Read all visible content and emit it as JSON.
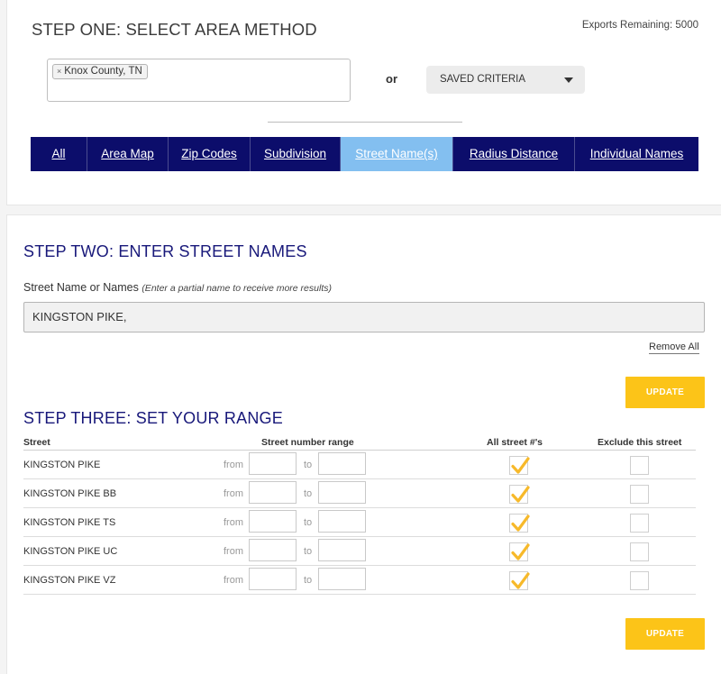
{
  "step1": {
    "title": "STEP ONE: SELECT AREA METHOD",
    "exports_remaining": "Exports Remaining: 5000",
    "area_chip": {
      "remove_glyph": "×",
      "label": "Knox County, TN"
    },
    "or_label": "or",
    "saved_criteria": {
      "selected": "SAVED CRITERIA",
      "icon": "caret-down-icon"
    },
    "tabs": [
      {
        "label": "All",
        "active": false
      },
      {
        "label": "Area Map",
        "active": false
      },
      {
        "label": "Zip Codes",
        "active": false
      },
      {
        "label": "Subdivision",
        "active": false
      },
      {
        "label": "Street Name(s)",
        "active": true
      },
      {
        "label": "Radius Distance",
        "active": false
      },
      {
        "label": "Individual Names",
        "active": false
      }
    ],
    "tab_colors": {
      "bar": "#0c0d6b",
      "active": "#83bff0"
    }
  },
  "step2": {
    "title": "STEP TWO: ENTER STREET NAMES",
    "field_label": "Street Name or Names",
    "field_hint": "(Enter a partial name to receive more results)",
    "field_value": "KINGSTON PIKE,",
    "remove_all_label": "Remove All",
    "update_label": "UPDATE"
  },
  "step3": {
    "title": "STEP THREE: SET YOUR RANGE",
    "columns": {
      "street": "Street",
      "range": "Street number range",
      "all": "All street #'s",
      "exclude": "Exclude this street"
    },
    "from_label": "from",
    "to_label": "to",
    "rows": [
      {
        "street": "KINGSTON PIKE",
        "from_value": "",
        "to_value": "",
        "all_checked": true,
        "exclude_checked": false
      },
      {
        "street": "KINGSTON PIKE BB",
        "from_value": "",
        "to_value": "",
        "all_checked": true,
        "exclude_checked": false
      },
      {
        "street": "KINGSTON PIKE TS",
        "from_value": "",
        "to_value": "",
        "all_checked": true,
        "exclude_checked": false
      },
      {
        "street": "KINGSTON PIKE UC",
        "from_value": "",
        "to_value": "",
        "all_checked": true,
        "exclude_checked": false
      },
      {
        "street": "KINGSTON PIKE VZ",
        "from_value": "",
        "to_value": "",
        "all_checked": true,
        "exclude_checked": false
      }
    ],
    "update_label": "UPDATE"
  },
  "colors": {
    "heading": "#18187a",
    "accent_button": "#fcc418",
    "checkmark": "#f7b92a"
  }
}
